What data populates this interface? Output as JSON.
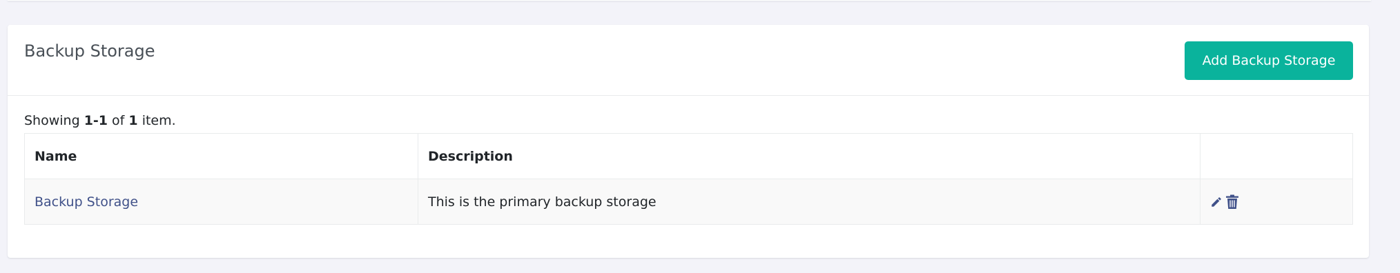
{
  "card": {
    "title": "Backup Storage",
    "add_button_label": "Add Backup Storage"
  },
  "summary": {
    "prefix": "Showing ",
    "range": "1-1",
    "middle": " of ",
    "total": "1",
    "suffix": " item."
  },
  "table": {
    "columns": [
      "Name",
      "Description",
      ""
    ],
    "rows": [
      {
        "name": "Backup Storage",
        "description": "This is the primary backup storage",
        "actions": [
          "pencil-icon",
          "trash-icon"
        ]
      }
    ]
  },
  "colors": {
    "accent": "#0ab39c",
    "link": "#405189",
    "background": "#f3f3f9"
  }
}
